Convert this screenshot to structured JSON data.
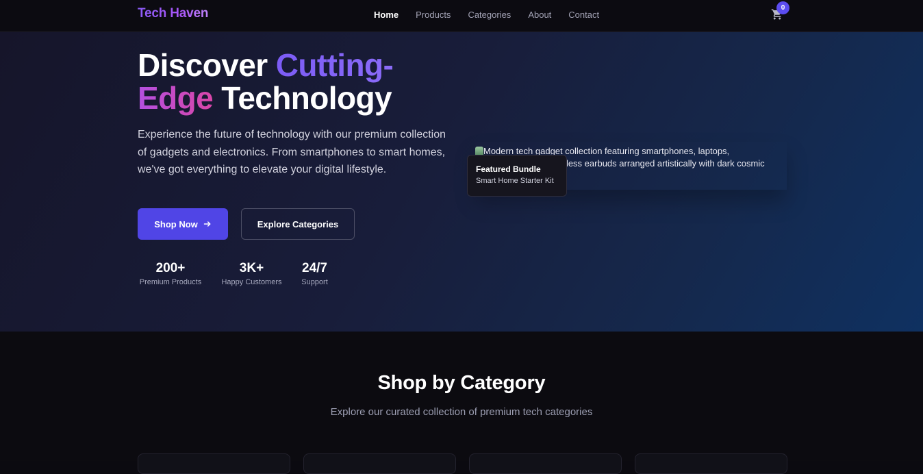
{
  "brand": {
    "name": "Tech Haven"
  },
  "nav": {
    "links": [
      {
        "label": "Home",
        "active": true
      },
      {
        "label": "Products",
        "active": false
      },
      {
        "label": "Categories",
        "active": false
      },
      {
        "label": "About",
        "active": false
      },
      {
        "label": "Contact",
        "active": false
      }
    ],
    "cart": {
      "icon": "cart-icon",
      "count": "0"
    }
  },
  "hero": {
    "title": {
      "part1": "Discover ",
      "part2": "Cutting-",
      "part3": "Edge",
      "part4": " Technology"
    },
    "description": "Experience the future of technology with our premium collection of gadgets and electronics. From smartphones to smart homes, we've got everything to elevate your digital lifestyle.",
    "primary_button": {
      "label": "Shop Now",
      "icon": "arrow-right-icon"
    },
    "secondary_button": {
      "label": "Explore Categories"
    },
    "stats": [
      {
        "value": "200+",
        "label": "Premium Products"
      },
      {
        "value": "3K+",
        "label": "Happy Customers"
      },
      {
        "value": "24/7",
        "label": "Support"
      }
    ],
    "image_alt": "Modern tech gadget collection featuring smartphones, laptops, smartwatches and wireless earbuds arranged artistically with dark cosmic",
    "featured": {
      "title": "Featured Bundle",
      "subtitle": "Smart Home Starter Kit"
    }
  },
  "categories_section": {
    "title": "Shop by Category",
    "subtitle": "Explore our curated collection of premium tech categories"
  },
  "colors": {
    "accent": "#5045e6",
    "background": "#0b0a10",
    "gradient_purple": "#7c5cf6",
    "gradient_pink": "#d946a8"
  }
}
